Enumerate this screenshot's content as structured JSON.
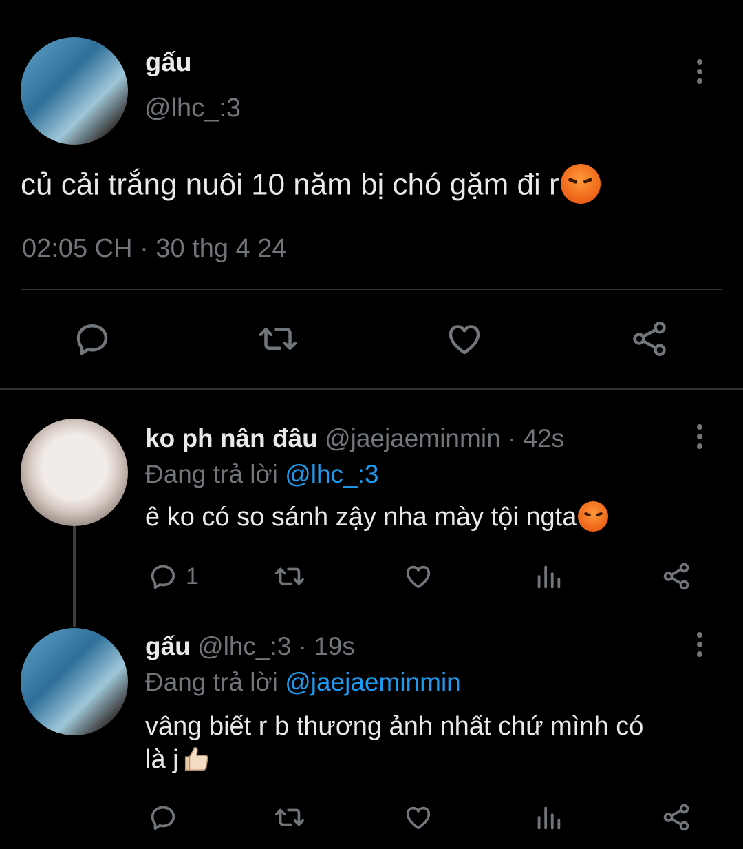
{
  "main_tweet": {
    "display_name": "gấu",
    "handle": "@lhc_:3",
    "text": "củ cải trắng nuôi 10 năm bị chó gặm đi r",
    "timestamp": "02:05 CH · 30 thg 4 24"
  },
  "replies": [
    {
      "display_name": "ko ph nân đâu",
      "handle": "@jaejaeminmin",
      "separator": "·",
      "age": "42s",
      "replying_prefix": "Đang trả lời",
      "replying_to": "@lhc_:3",
      "text": "ê ko có so sánh zậy nha mày tội ngta",
      "reply_count": "1"
    },
    {
      "display_name": "gấu",
      "handle": "@lhc_:3",
      "separator": "·",
      "age": "19s",
      "replying_prefix": "Đang trả lời",
      "replying_to": "@jaejaeminmin",
      "text_line1": "vâng biết r b thương ảnh nhất chứ mình có",
      "text_line2": "là j",
      "reply_count": ""
    }
  ],
  "icons": {
    "reply": "reply-icon",
    "retweet": "retweet-icon",
    "like": "heart-icon",
    "views": "analytics-icon",
    "share": "share-icon",
    "more": "more-icon",
    "emoji_angry": "angry-face-emoji",
    "emoji_thumb": "thumbs-up-emoji"
  },
  "colors": {
    "background": "#000000",
    "text": "#e7e9ea",
    "muted": "#71767b",
    "link": "#1d9bf0",
    "divider": "#2f3336"
  }
}
